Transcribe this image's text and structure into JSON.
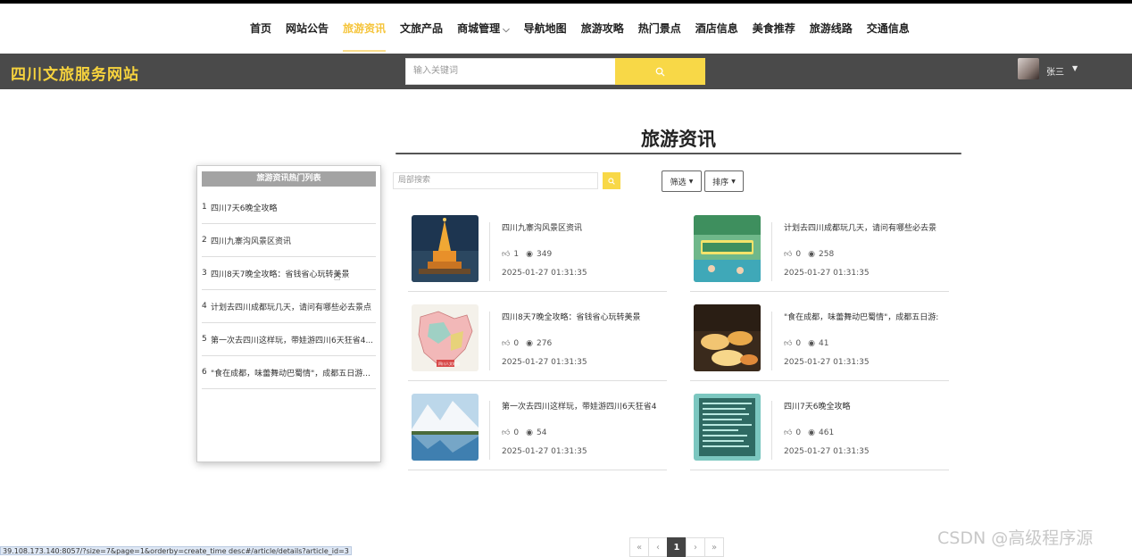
{
  "nav": {
    "items": [
      {
        "label": "首页"
      },
      {
        "label": "网站公告"
      },
      {
        "label": "旅游资讯",
        "active": true
      },
      {
        "label": "文旅产品"
      },
      {
        "label": "商城管理",
        "caret": true
      },
      {
        "label": "导航地图"
      },
      {
        "label": "旅游攻略"
      },
      {
        "label": "热门景点"
      },
      {
        "label": "酒店信息"
      },
      {
        "label": "美食推荐"
      },
      {
        "label": "旅游线路"
      },
      {
        "label": "交通信息"
      }
    ]
  },
  "header": {
    "brand": "四川文旅服务网站",
    "search_placeholder": "输入关键词",
    "username": "张三",
    "accent": "#f8d847"
  },
  "main": {
    "title": "旅游资讯",
    "local_search_placeholder": "局部搜索",
    "filter_label": "筛选",
    "sort_label": "排序"
  },
  "sidebar": {
    "title": "旅游资讯热门列表",
    "items": [
      {
        "num": "1",
        "text": "四川7天6晚全攻略"
      },
      {
        "num": "2",
        "text": "四川九寨沟风景区资讯"
      },
      {
        "num": "3",
        "text": "四川8天7晚全攻略：省钱省心玩转美景"
      },
      {
        "num": "4",
        "text": "计划去四川成都玩几天，请问有哪些必去景点"
      },
      {
        "num": "5",
        "text": "第一次去四川这样玩，带娃游四川6天狂省4..."
      },
      {
        "num": "6",
        "text": "\"食在成都，味蕾舞动巴蜀情\"，成都五日游..."
      }
    ]
  },
  "articles": [
    {
      "title": "四川九寨沟风景区资讯",
      "likes": "1",
      "views": "349",
      "date": "2025-01-27 01:31:35",
      "thumb": "pagoda"
    },
    {
      "title": "计划去四川成都玩几天，请问有哪些必去景",
      "likes": "0",
      "views": "258",
      "date": "2025-01-27 01:31:35",
      "thumb": "poster"
    },
    {
      "title": "四川8天7晚全攻略：省钱省心玩转美景",
      "likes": "0",
      "views": "276",
      "date": "2025-01-27 01:31:35",
      "thumb": "map",
      "thumb_label": "四川人文地图"
    },
    {
      "title": "\"食在成都，味蕾舞动巴蜀情\"，成都五日游:",
      "likes": "0",
      "views": "41",
      "date": "2025-01-27 01:31:35",
      "thumb": "food"
    },
    {
      "title": "第一次去四川这样玩，带娃游四川6天狂省4",
      "likes": "0",
      "views": "54",
      "date": "2025-01-27 01:31:35",
      "thumb": "mountain"
    },
    {
      "title": "四川7天6晚全攻略",
      "likes": "0",
      "views": "461",
      "date": "2025-01-27 01:31:35",
      "thumb": "text"
    }
  ],
  "pager": {
    "first": "«",
    "prev": "‹",
    "current": "1",
    "next": "›",
    "last": "»"
  },
  "status_url": "39.108.173.140:8057/?size=7&page=1&orderby=create_time desc#/article/details?article_id=3",
  "watermark": "CSDN @高级程序源"
}
